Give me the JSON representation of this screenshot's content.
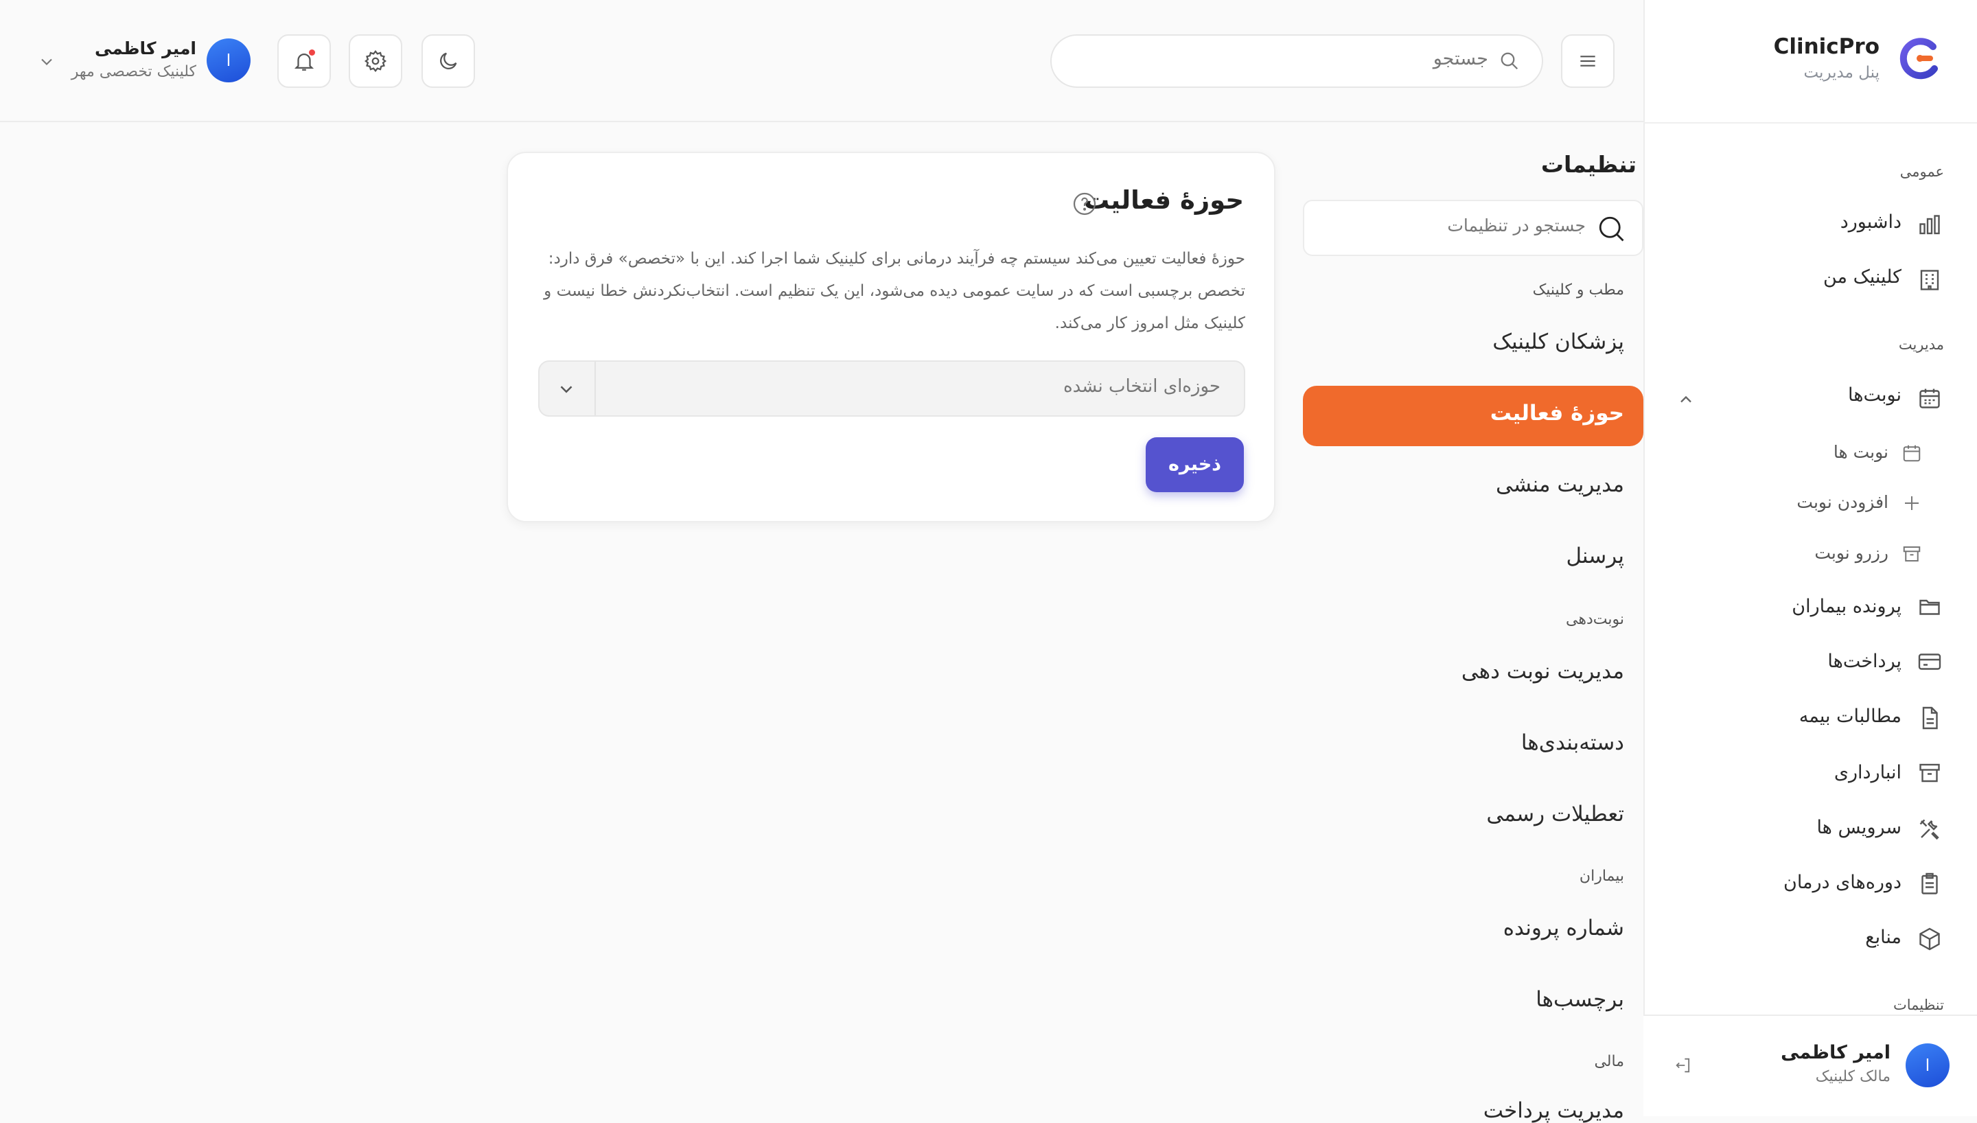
{
  "brand": {
    "name": "ClinicPro",
    "subtitle": "پنل مدیریت"
  },
  "header": {
    "search_placeholder": "جستجو",
    "user": {
      "name": "امیر کاظمی",
      "clinic": "کلینیک تخصصی مهر",
      "avatar_letter": "ا"
    }
  },
  "sidebar": {
    "sections": {
      "general": "عمومی",
      "management": "مدیریت",
      "settings": "تنظیمات"
    },
    "items": {
      "dashboard": "داشبورد",
      "my_clinic": "کلینیک من",
      "appointments": "نوبت‌ها",
      "appointments_list": "نوبت ها",
      "add_appointment": "افزودن نوبت",
      "reserve_appointment": "رزرو نوبت",
      "patient_records": "پرونده بیماران",
      "payments": "پرداخت‌ها",
      "insurance_claims": "مطالبات بیمه",
      "warehouse": "انبارداری",
      "services": "سرویس ها",
      "treatment_courses": "دوره‌های درمان",
      "resources": "منابع"
    },
    "user": {
      "name": "امیر کاظمی",
      "role": "مالک کلینیک",
      "avatar_letter": "ا"
    }
  },
  "settings_nav": {
    "title": "تنظیمات",
    "search_placeholder": "جستجو در تنظیمات",
    "groups": {
      "office": "مطب و کلینیک",
      "scheduling": "نوبت‌دهی",
      "patients": "بیماران",
      "finance": "مالی"
    },
    "items": {
      "doctors": "پزشکان کلینیک",
      "activity_scope": "حوزهٔ فعالیت",
      "secretary": "مدیریت منشی",
      "staff": "پرسنل",
      "schedule_mgmt": "مدیریت نوبت دهی",
      "categories": "دسته‌بندی‌ها",
      "holidays": "تعطیلات رسمی",
      "record_number": "شماره پرونده",
      "tags": "برچسب‌ها",
      "payment_mgmt": "مدیریت پرداخت"
    }
  },
  "card": {
    "title": "حوزهٔ فعالیت",
    "description": "حوزهٔ فعالیت تعیین می‌کند سیستم چه فرآیند درمانی برای کلینیک شما اجرا کند. این با «تخصص» فرق دارد: تخصص برچسبی است که در سایت عمومی دیده می‌شود، این یک تنظیم است. انتخاب‌نکردنش خطا نیست و کلینیک مثل امروز کار می‌کند.",
    "select_value": "حوزه‌ای انتخاب نشده",
    "save_label": "ذخیره"
  },
  "colors": {
    "accent_orange": "#f06a2c",
    "primary_button": "#5553cf",
    "avatar_blue": "#2563eb",
    "notification_dot": "#ef4444"
  }
}
